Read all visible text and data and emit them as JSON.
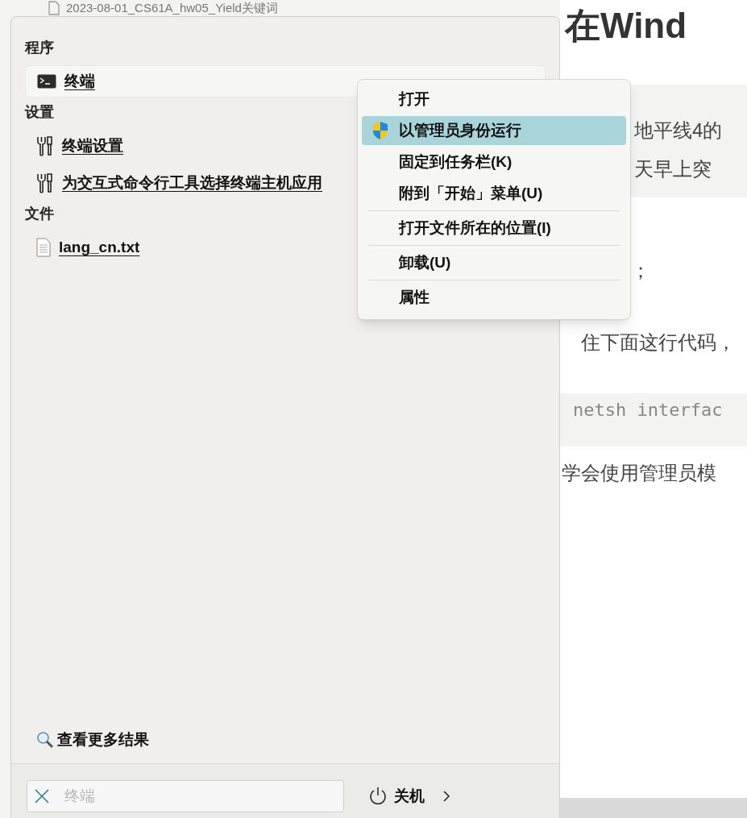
{
  "background_file": {
    "name": "2023-08-01_CS61A_hw05_Yield关键词"
  },
  "article": {
    "heading": "在Wind",
    "lines": [
      {
        "kind": "quote",
        "text": "地平线4的"
      },
      {
        "kind": "quote",
        "text": "天早上突"
      },
      {
        "kind": "text",
        "text": "；"
      },
      {
        "kind": "text",
        "text": "住下面这行代码，"
      },
      {
        "kind": "code",
        "text": "netsh interfac"
      },
      {
        "kind": "text",
        "text": "学会使用管理员模"
      }
    ]
  },
  "start_menu": {
    "sections": [
      {
        "title": "程序",
        "items": [
          {
            "label": "终端",
            "kind": "terminal",
            "selected": true
          }
        ]
      },
      {
        "title": "设置",
        "items": [
          {
            "label": "终端设置",
            "kind": "setting",
            "selected": false
          },
          {
            "label": "为交互式命令行工具选择终端主机应用",
            "kind": "setting",
            "selected": false
          }
        ]
      },
      {
        "title": "文件",
        "items": [
          {
            "label": "lang_cn.txt",
            "kind": "file",
            "selected": false
          }
        ]
      }
    ],
    "more_results": "查看更多结果",
    "search": {
      "placeholder": "终端"
    },
    "power": {
      "label": "关机"
    }
  },
  "context_menu": {
    "items": [
      {
        "kind": "command",
        "label": "打开",
        "selected": false
      },
      {
        "kind": "admin",
        "label": "以管理员身份运行",
        "selected": true
      },
      {
        "kind": "command",
        "label": "固定到任务栏(K)",
        "selected": false
      },
      {
        "kind": "command",
        "label": "附到「开始」菜单(U)",
        "selected": false
      },
      {
        "kind": "separator"
      },
      {
        "kind": "command",
        "label": "打开文件所在的位置(I)",
        "selected": false
      },
      {
        "kind": "separator"
      },
      {
        "kind": "command",
        "label": "卸载(U)",
        "selected": false
      },
      {
        "kind": "separator"
      },
      {
        "kind": "command",
        "label": "属性",
        "selected": false
      }
    ]
  }
}
